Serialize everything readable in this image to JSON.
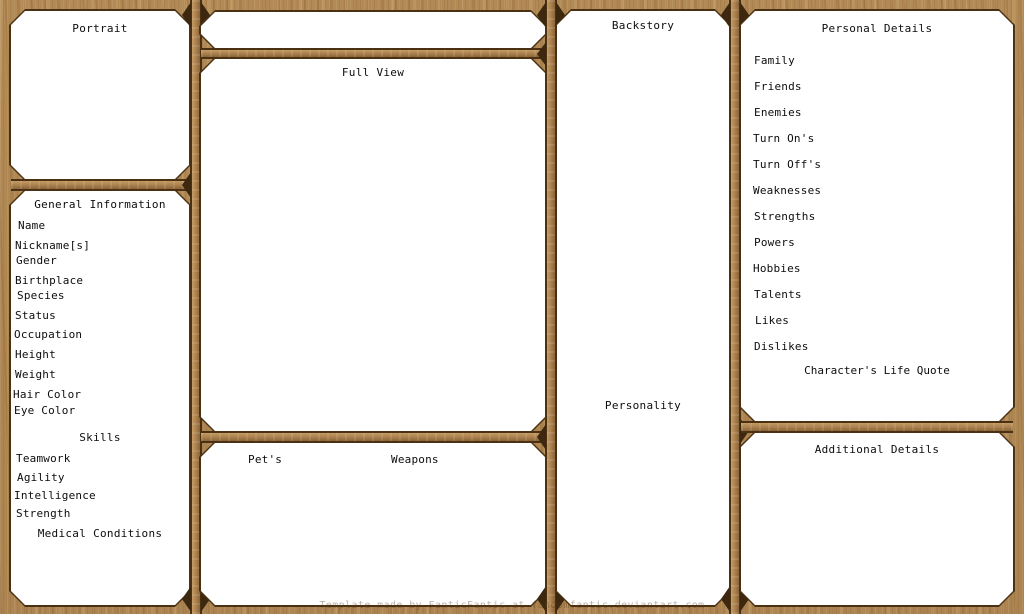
{
  "document": {
    "kind": "character-sheet-template",
    "watermark": "Template made by FanticFantic at fandomfantic.deviantart.com"
  },
  "theme": {
    "wood": "#b08a56",
    "frame_dark": "#4a3113",
    "panel": "#ffffff",
    "text": "#0d0d0d"
  },
  "left_column": {
    "portrait": {
      "header": "Portrait",
      "content": ""
    },
    "general_information": {
      "header": "General Information",
      "fields": [
        "Name",
        "Nickname[s]",
        "Gender",
        "Birthplace",
        "Species",
        "Status",
        "Occupation",
        "Height",
        "Weight",
        "Hair Color",
        "Eye Color"
      ]
    },
    "skills": {
      "header": "Skills",
      "fields": [
        "Teamwork",
        "Agility",
        "Intelligence",
        "Strength"
      ]
    },
    "medical_conditions": {
      "header": "Medical Conditions",
      "content": ""
    }
  },
  "center_column": {
    "name_bar": {
      "label": "",
      "content": ""
    },
    "full_view": {
      "header": "Full View",
      "content": ""
    },
    "pets": {
      "header": "Pet's",
      "content": ""
    },
    "weapons": {
      "header": "Weapons",
      "content": ""
    }
  },
  "middle_column": {
    "backstory": {
      "header": "Backstory",
      "content": ""
    },
    "personality": {
      "header": "Personality",
      "content": ""
    }
  },
  "right_column": {
    "personal_details": {
      "header": "Personal Details",
      "fields": [
        "Family",
        "Friends",
        "Enemies",
        "Turn On's",
        "Turn Off's",
        "Weaknesses",
        "Strengths",
        "Powers",
        "Hobbies",
        "Talents",
        "Likes",
        "Dislikes"
      ],
      "quote_header": "Character's Life Quote",
      "quote": ""
    },
    "additional_details": {
      "header": "Additional Details",
      "content": ""
    }
  }
}
